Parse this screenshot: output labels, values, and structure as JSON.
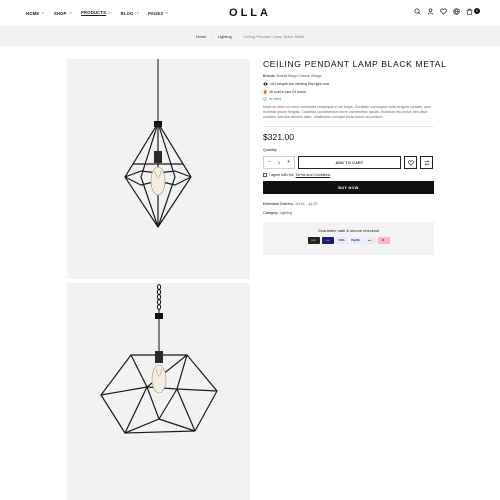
{
  "header": {
    "nav": [
      {
        "label": "HOME",
        "dropdown": true,
        "active": false
      },
      {
        "label": "SHOP",
        "dropdown": true,
        "active": false
      },
      {
        "label": "PRODUCTS",
        "dropdown": true,
        "active": true
      },
      {
        "label": "BLOG",
        "dropdown": true,
        "active": false
      },
      {
        "label": "PAGES",
        "dropdown": true,
        "active": false
      }
    ],
    "logo": "OLLA",
    "icons": [
      "search-icon",
      "account-icon",
      "wishlist-icon",
      "currency-icon",
      "cart-icon"
    ],
    "cart_count": "0"
  },
  "breadcrumb": {
    "home": "Home",
    "category": "Lighting",
    "current": "Ceiling Pendant Lamp Black Metal",
    "separator": "›"
  },
  "product": {
    "title": "CEILING PENDANT LAMP BLACK METAL",
    "brands_label": "Brands:",
    "brands_value": "Amelia Bingo Cresce Village",
    "viewing": "104 people are viewing this right now",
    "sold": "26 sold in last 24 hours",
    "stock": "In stock",
    "description": "Nunc eu dolor eu nunc commodo consequat in vel turpis. Curabitur consequat nulla at ligula ultricies, quis molestie ipsum fringilla. Curabitur condimentum leo in consectetur iaculis. Vivamus nec lectus nec diam sodales, ultricies ultricies diam. Vestibulum volutpat porta lorem vel pretium.",
    "price": "$321.00",
    "quantity_label": "Quantity:",
    "quantity": "1",
    "minus": "−",
    "plus": "+",
    "add_to_cart": "ADD TO CART",
    "agree_text": "I agree with the ",
    "terms": "Terms and Conditions",
    "buy_now": "BUY NOW",
    "delivery_label": "Estimated Delivery:",
    "delivery_value": "Jul 18 - Jul 23",
    "category_label": "Category:",
    "category_value": "Lighting",
    "checkout_text": "Guarantee safe & secure checkout",
    "payments": [
      {
        "name": "Amazon",
        "label": "pay",
        "bg": "#222222",
        "fg": "#ff9900"
      },
      {
        "name": "Mastercard",
        "label": "●●",
        "bg": "#1a1f71",
        "fg": "#f79e1b"
      },
      {
        "name": "Visa",
        "label": "VISA",
        "bg": "#e8ecf7",
        "fg": "#1a1f71"
      },
      {
        "name": "PayPal",
        "label": "PayPal",
        "bg": "#e7eef9",
        "fg": "#003087"
      },
      {
        "name": "Maestro",
        "label": "●●",
        "bg": "#e8ecf7",
        "fg": "#cc0000"
      },
      {
        "name": "Klarna",
        "label": "K.",
        "bg": "#ffb3c7",
        "fg": "#111111"
      }
    ]
  },
  "colors": {
    "accent": "#111111",
    "in_stock": "#2a9a3e",
    "breadcrumb_bg": "#f2f2f2"
  }
}
